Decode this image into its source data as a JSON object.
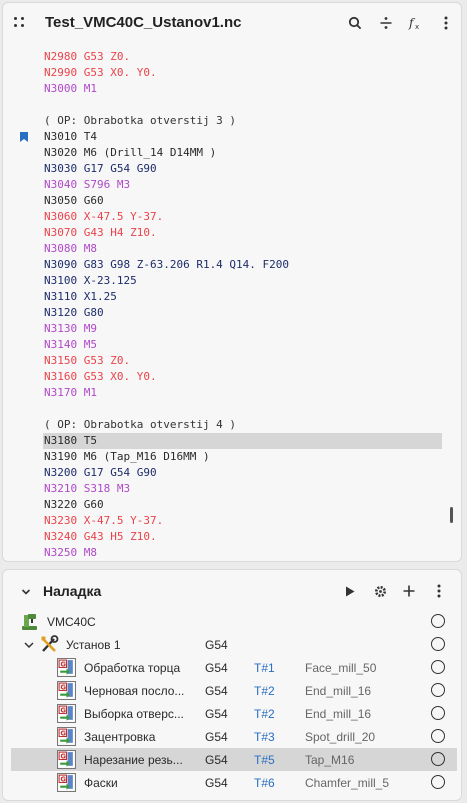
{
  "header": {
    "title": "Test_VMC40C_Ustanov1.nc",
    "icons": [
      "drag-handle",
      "search-icon",
      "split-icon",
      "function-icon",
      "more-vert-icon"
    ]
  },
  "code": {
    "lines": [
      {
        "text": "N2980 G53 Z0.",
        "color": "red"
      },
      {
        "text": "N2990 G53 X0. Y0.",
        "color": "red"
      },
      {
        "text": "N3000 M1",
        "color": "magenta"
      },
      {
        "text": "",
        "color": "black"
      },
      {
        "text": "( OP: Obrabotka otverstij 3 )",
        "color": "comment"
      },
      {
        "text": "N3010 T4",
        "color": "black",
        "bookmark": true
      },
      {
        "text": "N3020 M6 (Drill_14 D14MM )",
        "color": "black"
      },
      {
        "text": "N3030 G17 G54 G90",
        "color": "blue"
      },
      {
        "text": "N3040 S796 M3",
        "color": "magenta"
      },
      {
        "text": "N3050 G60",
        "color": "black"
      },
      {
        "text": "N3060 X-47.5 Y-37.",
        "color": "red"
      },
      {
        "text": "N3070 G43 H4 Z10.",
        "color": "red"
      },
      {
        "text": "N3080 M8",
        "color": "magenta"
      },
      {
        "text": "N3090 G83 G98 Z-63.206 R1.4 Q14. F200",
        "color": "blue"
      },
      {
        "text": "N3100 X-23.125",
        "color": "blue"
      },
      {
        "text": "N3110 X1.25",
        "color": "blue"
      },
      {
        "text": "N3120 G80",
        "color": "blue"
      },
      {
        "text": "N3130 M9",
        "color": "magenta"
      },
      {
        "text": "N3140 M5",
        "color": "magenta"
      },
      {
        "text": "N3150 G53 Z0.",
        "color": "red"
      },
      {
        "text": "N3160 G53 X0. Y0.",
        "color": "red"
      },
      {
        "text": "N3170 M1",
        "color": "magenta"
      },
      {
        "text": "",
        "color": "black"
      },
      {
        "text": "( OP: Obrabotka otverstij 4 )",
        "color": "comment"
      },
      {
        "text": "N3180 T5",
        "color": "black",
        "selected": true
      },
      {
        "text": "N3190 M6 (Tap_M16 D16MM )",
        "color": "black"
      },
      {
        "text": "N3200 G17 G54 G90",
        "color": "blue"
      },
      {
        "text": "N3210 S318 M3",
        "color": "magenta"
      },
      {
        "text": "N3220 G60",
        "color": "black"
      },
      {
        "text": "N3230 X-47.5 Y-37.",
        "color": "red"
      },
      {
        "text": "N3240 G43 H5 Z10.",
        "color": "red"
      },
      {
        "text": "N3250 M8",
        "color": "magenta"
      }
    ]
  },
  "setup_panel": {
    "title": "Наладка",
    "icons": [
      "play-icon",
      "settings-icon",
      "add-icon",
      "more-vert-icon"
    ],
    "machine": {
      "name": "VMC40C"
    },
    "setup": {
      "name": "Установ 1",
      "wcs": "G54"
    },
    "operations": [
      {
        "name": "Обработка торца",
        "wcs": "G54",
        "tool": "T#1",
        "tool_name": "Face_mill_50"
      },
      {
        "name": "Черновая посло...",
        "wcs": "G54",
        "tool": "T#2",
        "tool_name": "End_mill_16"
      },
      {
        "name": "Выборка отверс...",
        "wcs": "G54",
        "tool": "T#2",
        "tool_name": "End_mill_16"
      },
      {
        "name": "Зацентровка",
        "wcs": "G54",
        "tool": "T#3",
        "tool_name": "Spot_drill_20"
      },
      {
        "name": "Нарезание резь...",
        "wcs": "G54",
        "tool": "T#5",
        "tool_name": "Tap_M16",
        "selected": true
      },
      {
        "name": "Фаски",
        "wcs": "G54",
        "tool": "T#6",
        "tool_name": "Chamfer_mill_5"
      }
    ]
  },
  "colors": {
    "red": "#e8434b",
    "magenta": "#b048c9",
    "blue": "#1d2c6a",
    "black": "#2a2a2a",
    "tool_blue": "#2a6fc1",
    "selection": "#d6d6d6",
    "bookmark": "#2a6fc1"
  }
}
